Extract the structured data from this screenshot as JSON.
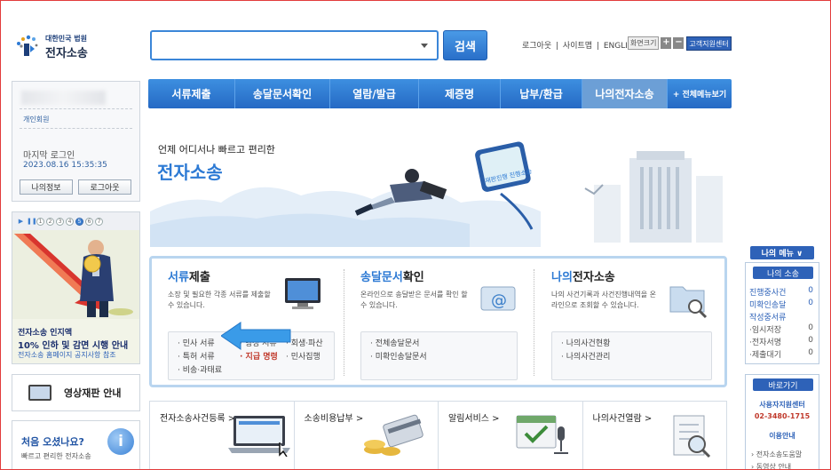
{
  "header": {
    "logo_small": "대한민국 법원",
    "logo_big": "전자소송",
    "search_button": "검색",
    "links": [
      "로그아웃",
      "|",
      "사이트맵",
      "|",
      "ENGLISH"
    ],
    "fontsize_label": "화면크기",
    "fontsize_plus": "+",
    "fontsize_minus": "−",
    "help_center": "고객지원센터"
  },
  "nav": {
    "items": [
      "서류제출",
      "송달문서확인",
      "열람/발급",
      "제증명",
      "납부/환급",
      "나의전자소송"
    ],
    "all_menu": "+ 전체메뉴보기",
    "active_index": 5
  },
  "login": {
    "member_type": "개인회원",
    "last_login_label": "마지막 로그인",
    "last_login_time": "2023.08.16 15:35:35",
    "my_info": "나의정보",
    "logout": "로그아웃"
  },
  "banner": {
    "controls": [
      "▶",
      "❚❚"
    ],
    "pages": [
      "1",
      "2",
      "3",
      "4",
      "5",
      "6",
      "7"
    ],
    "active_page": 5,
    "line1": "전자소송 인지액",
    "line2": "10% 인하 및 감면 시행 안내",
    "line3": "전자소송 홈페이지 공지사항 참조"
  },
  "video": {
    "label": "영상재판 안내"
  },
  "first_visit": {
    "question": "처음 오셨나요?",
    "sub": "빠르고 편리한 전자소송",
    "icon_glyph": "i"
  },
  "hero": {
    "tagline": "언제 어디서나 빠르고 편리한",
    "title": "전자소송",
    "screen_text": "재판진행 진행소송"
  },
  "services": [
    {
      "title_hl": "서류",
      "title_rest": "제출",
      "desc": "소장 및 필요한 각종 서류를 제출할 수 있습니다.",
      "items_left": [
        "· 민사 서류",
        "· 특허 서류",
        "· 비송·과태료"
      ],
      "items_mid": [
        "",
        "· 행정 서류",
        "· 지급 명령"
      ],
      "items_right": [
        "· 회생·파산",
        "· 민사집행",
        ""
      ]
    },
    {
      "title_hl": "송달문서",
      "title_rest": "확인",
      "desc": "온라인으로 송달받은 문서를 확인 할 수 있습니다.",
      "items": [
        "· 전체송달문서",
        "· 미확인송달문서"
      ]
    },
    {
      "title_hl": "나의",
      "title_rest": "전자소송",
      "desc": "나의 사건기록과 사건진행내역을 온라인으로 조회할 수 있습니다.",
      "items": [
        "· 나의사건현황",
        "· 나의사건관리"
      ]
    }
  ],
  "bottom_row": [
    "전자소송사건등록 >",
    "소송비용납부 >",
    "알림서비스 >",
    "나의사건열람 >"
  ],
  "right_panel": {
    "menu_toggle": "나의 메뉴 ∨",
    "my_case_header": "나의 소송",
    "rows": [
      {
        "label": "진행중사건",
        "value": "0"
      },
      {
        "label": "미확인송달",
        "value": "0"
      },
      {
        "label": "작성중서류",
        "value": ""
      },
      {
        "label": "·임시저장",
        "value": "0"
      },
      {
        "label": "·전자서명",
        "value": "0"
      },
      {
        "label": "·제출대기",
        "value": "0"
      }
    ],
    "shortcut_header": "바로가기",
    "support_center": "사용자지원센터",
    "phone": "02-3480-1715",
    "guide": "이용안내",
    "link1": "› 전자소송도움말",
    "link2": "› 동영상 안내"
  },
  "colors": {
    "primary": "#2d7ad4",
    "nav": "#2f75cf",
    "frame": "#e23b3b"
  }
}
